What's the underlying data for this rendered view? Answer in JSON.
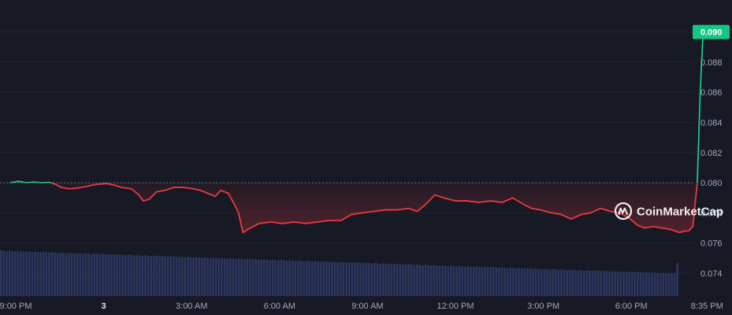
{
  "watermark": {
    "text": "CoinMarketCap"
  },
  "colors": {
    "background": "#171924",
    "grid": "#22252f",
    "up": "#16c784",
    "down": "#ea3943",
    "volume": "#2e3a66",
    "baseline": "#7d8292"
  },
  "chart_data": {
    "type": "line",
    "title": "",
    "xlabel": "",
    "ylabel": "",
    "ylim": [
      0.0725,
      0.0905
    ],
    "yticks": [
      "0.074",
      "0.076",
      "0.078",
      "0.080",
      "0.082",
      "0.084",
      "0.086",
      "0.088",
      "0.090"
    ],
    "yticks_values": [
      0.074,
      0.076,
      0.078,
      0.08,
      0.082,
      0.084,
      0.086,
      0.088,
      0.09
    ],
    "xticks": [
      "9:00 PM",
      "3",
      "3:00 AM",
      "6:00 AM",
      "9:00 AM",
      "12:00 PM",
      "3:00 PM",
      "6:00 PM",
      "8:35 PM"
    ],
    "xticks_hours": [
      0,
      3,
      6,
      9,
      12,
      15,
      18,
      21,
      23.583
    ],
    "x_unit": "hours from 9:00 PM",
    "baseline": 0.08,
    "current_price_label": "0.090",
    "current_price": 0.09,
    "grid": true,
    "series": [
      {
        "kind": "price",
        "points": [
          [
            -0.2,
            0.08
          ],
          [
            0.1,
            0.0801
          ],
          [
            0.35,
            0.08
          ],
          [
            0.6,
            0.08005
          ],
          [
            0.9,
            0.08
          ],
          [
            1.15,
            0.08003
          ],
          [
            1.35,
            0.0799
          ],
          [
            1.55,
            0.0797
          ],
          [
            1.8,
            0.0796
          ],
          [
            2.1,
            0.07965
          ],
          [
            2.4,
            0.07975
          ],
          [
            2.75,
            0.0799
          ],
          [
            3.1,
            0.07995
          ],
          [
            3.35,
            0.07985
          ],
          [
            3.6,
            0.0797
          ],
          [
            3.95,
            0.0796
          ],
          [
            4.2,
            0.0792
          ],
          [
            4.35,
            0.0788
          ],
          [
            4.55,
            0.0789
          ],
          [
            4.8,
            0.0794
          ],
          [
            5.1,
            0.0795
          ],
          [
            5.4,
            0.0797
          ],
          [
            5.7,
            0.0797
          ],
          [
            6.05,
            0.0796
          ],
          [
            6.3,
            0.0795
          ],
          [
            6.55,
            0.0793
          ],
          [
            6.8,
            0.0791
          ],
          [
            7.0,
            0.0795
          ],
          [
            7.25,
            0.0793
          ],
          [
            7.45,
            0.0786
          ],
          [
            7.6,
            0.078
          ],
          [
            7.75,
            0.0767
          ],
          [
            8.0,
            0.077
          ],
          [
            8.3,
            0.0773
          ],
          [
            8.7,
            0.0774
          ],
          [
            9.1,
            0.0773
          ],
          [
            9.5,
            0.0774
          ],
          [
            9.9,
            0.0773
          ],
          [
            10.3,
            0.0774
          ],
          [
            10.7,
            0.0775
          ],
          [
            11.1,
            0.0775
          ],
          [
            11.45,
            0.0779
          ],
          [
            11.8,
            0.078
          ],
          [
            12.2,
            0.0781
          ],
          [
            12.6,
            0.0782
          ],
          [
            13.0,
            0.0782
          ],
          [
            13.4,
            0.0783
          ],
          [
            13.7,
            0.0781
          ],
          [
            14.0,
            0.0786
          ],
          [
            14.3,
            0.0792
          ],
          [
            14.6,
            0.079
          ],
          [
            15.0,
            0.0788
          ],
          [
            15.4,
            0.0788
          ],
          [
            15.8,
            0.0787
          ],
          [
            16.2,
            0.0788
          ],
          [
            16.6,
            0.0787
          ],
          [
            16.95,
            0.079
          ],
          [
            17.3,
            0.0786
          ],
          [
            17.6,
            0.0783
          ],
          [
            17.9,
            0.0782
          ],
          [
            18.3,
            0.078
          ],
          [
            18.6,
            0.0779
          ],
          [
            18.95,
            0.0776
          ],
          [
            19.3,
            0.0779
          ],
          [
            19.6,
            0.078
          ],
          [
            19.95,
            0.0783
          ],
          [
            20.3,
            0.0781
          ],
          [
            20.6,
            0.078
          ],
          [
            20.9,
            0.0777
          ],
          [
            21.2,
            0.0772
          ],
          [
            21.45,
            0.077
          ],
          [
            21.75,
            0.0771
          ],
          [
            22.05,
            0.077
          ],
          [
            22.35,
            0.0769
          ],
          [
            22.65,
            0.0767
          ],
          [
            22.8,
            0.0768
          ],
          [
            22.95,
            0.0768
          ],
          [
            23.1,
            0.0771
          ],
          [
            23.25,
            0.08
          ],
          [
            23.35,
            0.086
          ],
          [
            23.45,
            0.09
          ]
        ]
      }
    ]
  }
}
